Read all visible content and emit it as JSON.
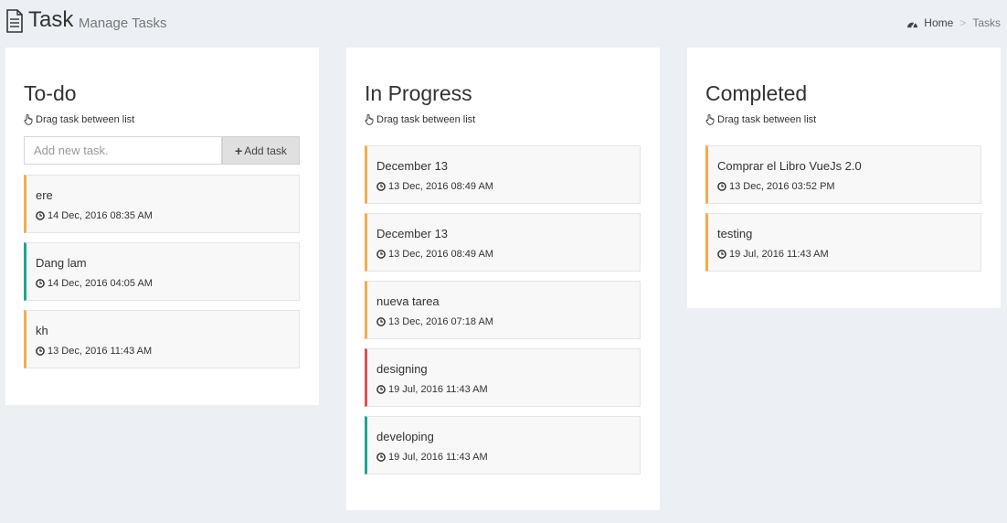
{
  "header": {
    "title": "Task",
    "subtitle": "Manage Tasks",
    "breadcrumb": {
      "home": "Home",
      "separator": ">",
      "current": "Tasks"
    }
  },
  "columns": [
    {
      "title": "To-do",
      "hint": "Drag task between list",
      "add_placeholder": "Add new task.",
      "add_button": "Add task",
      "tasks": [
        {
          "title": "ere",
          "time": "14 Dec, 2016 08:35 AM",
          "status_color": "#f0ad4e"
        },
        {
          "title": "Dang lam",
          "time": "14 Dec, 2016 04:05 AM",
          "status_color": "#1fa58e"
        },
        {
          "title": "kh",
          "time": "13 Dec, 2016 11:43 AM",
          "status_color": "#f0ad4e"
        }
      ]
    },
    {
      "title": "In Progress",
      "hint": "Drag task between list",
      "tasks": [
        {
          "title": "December 13",
          "time": "13 Dec, 2016 08:49 AM",
          "status_color": "#f0ad4e"
        },
        {
          "title": "December 13",
          "time": "13 Dec, 2016 08:49 AM",
          "status_color": "#f0ad4e"
        },
        {
          "title": "nueva tarea",
          "time": "13 Dec, 2016 07:18 AM",
          "status_color": "#f0ad4e"
        },
        {
          "title": "designing",
          "time": "19 Jul, 2016 11:43 AM",
          "status_color": "#d9534f"
        },
        {
          "title": "developing",
          "time": "19 Jul, 2016 11:43 AM",
          "status_color": "#1fa58e"
        }
      ]
    },
    {
      "title": "Completed",
      "hint": "Drag task between list",
      "tasks": [
        {
          "title": "Comprar el Libro VueJs 2.0",
          "time": "13 Dec, 2016 03:52 PM",
          "status_color": "#f0ad4e"
        },
        {
          "title": "testing",
          "time": "19 Jul, 2016 11:43 AM",
          "status_color": "#f0ad4e"
        }
      ]
    }
  ],
  "icons": {
    "page": "file-text-icon",
    "breadcrumb_home": "dashboard-icon",
    "hint": "hand-pointer-icon",
    "add": "plus-icon",
    "time": "clock-icon"
  }
}
